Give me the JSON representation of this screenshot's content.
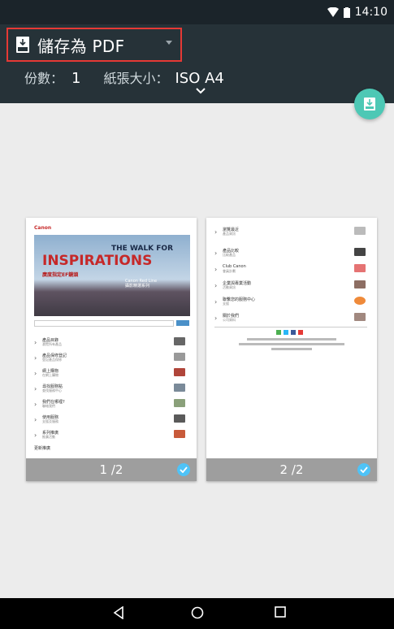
{
  "status_bar": {
    "time": "14:10"
  },
  "header": {
    "destination": "儲存為 PDF",
    "copies_label": "份數：",
    "copies_value": "1",
    "paper_label": "紙張大小：",
    "paper_value": "ISO A4"
  },
  "pages": [
    {
      "label": "1 /2",
      "brand": "Canon",
      "hero_title_1": "THE WALK FOR",
      "hero_title_2": "INSPIRATIONS",
      "hero_subtitle": "廣度指定EF鏡頭",
      "hero_promo": "Canon Red Line\n攝影精選系列",
      "rows": [
        {
          "title": "產品目錄",
          "sub": "瀏覽所有產品"
        },
        {
          "title": "產品保修登記",
          "sub": "登記產品保修"
        },
        {
          "title": "網上購物",
          "sub": "在網上購物"
        },
        {
          "title": "尋找服務點",
          "sub": "查找服務中心"
        },
        {
          "title": "我們在哪裡?",
          "sub": "聯絡我們"
        },
        {
          "title": "使用服務",
          "sub": "支援及服務"
        },
        {
          "title": "系列推廣",
          "sub": "推廣活動"
        },
        {
          "title": "更新推廣",
          "sub": ""
        }
      ]
    },
    {
      "label": "2 /2",
      "rows": [
        {
          "title": "瀏覽最近",
          "sub": "產品資訊"
        },
        {
          "title": "產品比較",
          "sub": "比較產品"
        },
        {
          "title": "Club Canon",
          "sub": "會員計劃"
        },
        {
          "title": "企業與專業活動",
          "sub": "活動資訊"
        },
        {
          "title": "聯繫您的服務中心",
          "sub": "支援"
        },
        {
          "title": "關於我們",
          "sub": "公司資料"
        }
      ]
    }
  ],
  "colors": {
    "header_bg": "#263238",
    "status_bg": "#1b242a",
    "highlight": "#e53935",
    "fab": "#4dc8b5",
    "check": "#4fc3f7"
  }
}
